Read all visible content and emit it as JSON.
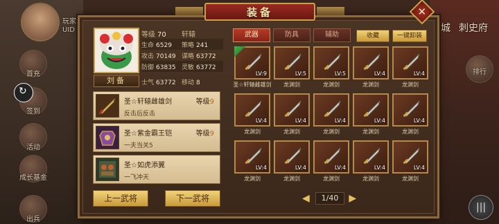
{
  "background": {
    "top_left_label_1": "玩家",
    "top_left_label_2": "UID",
    "top_right_labels": [
      "城",
      "刺史府"
    ],
    "left_menu": [
      "首充",
      "签到",
      "活动",
      "成长基金",
      "出兵"
    ],
    "right_menu": [
      "排行"
    ]
  },
  "panel": {
    "title": "装备",
    "close_symbol": "✕"
  },
  "hero": {
    "name_tag": "刘备",
    "stats": [
      [
        {
          "k": "等级",
          "v": "70"
        },
        {
          "k": "轩辕",
          "v": ""
        }
      ],
      [
        {
          "k": "生命",
          "v": "6529"
        },
        {
          "k": "策略",
          "v": "241"
        }
      ],
      [
        {
          "k": "攻击",
          "v": "70149"
        },
        {
          "k": "谋略",
          "v": "63772"
        }
      ],
      [
        {
          "k": "防御",
          "v": "63835"
        },
        {
          "k": "灵敏",
          "v": "63772"
        }
      ],
      [
        {
          "k": "士气",
          "v": "63772"
        },
        {
          "k": "移动",
          "v": "8"
        }
      ]
    ]
  },
  "equipped": [
    {
      "name": "圣☆轩辕雌雄剑",
      "level_label": "等级",
      "level": "9",
      "desc": "反击后反击"
    },
    {
      "name": "圣☆紫金霸王铠",
      "level_label": "等级",
      "level": "9",
      "desc": "一夫当关5"
    },
    {
      "name": "圣☆如虎添翼",
      "level_label": "",
      "level": "",
      "desc": "一飞冲天"
    }
  ],
  "buttons": {
    "prev_hero": "上一武将",
    "next_hero": "下一武将",
    "collect": "收藏",
    "unequip_all": "一键卸装"
  },
  "tabs": [
    {
      "label": "武器",
      "active": true
    },
    {
      "label": "防具",
      "active": false
    },
    {
      "label": "辅助",
      "active": false
    }
  ],
  "inventory": [
    {
      "name": "圣☆轩辕雌雄剑",
      "lv": "LV:9",
      "badge": true
    },
    {
      "name": "龙渊剑",
      "lv": "LV:5",
      "badge": false
    },
    {
      "name": "龙渊剑",
      "lv": "LV:5",
      "badge": false
    },
    {
      "name": "龙渊剑",
      "lv": "LV:4",
      "badge": false
    },
    {
      "name": "龙渊剑",
      "lv": "LV:4",
      "badge": false
    },
    {
      "name": "龙渊剑",
      "lv": "LV:4",
      "badge": false
    },
    {
      "name": "龙渊剑",
      "lv": "LV:4",
      "badge": false
    },
    {
      "name": "龙渊剑",
      "lv": "LV:4",
      "badge": false
    },
    {
      "name": "龙渊剑",
      "lv": "LV:4",
      "badge": false
    },
    {
      "name": "龙渊剑",
      "lv": "LV:4",
      "badge": false
    },
    {
      "name": "龙渊剑",
      "lv": "LV:4",
      "badge": false
    },
    {
      "name": "龙渊剑",
      "lv": "LV:4",
      "badge": false
    },
    {
      "name": "龙渊剑",
      "lv": "LV:4",
      "badge": false
    },
    {
      "name": "龙渊剑",
      "lv": "LV:4",
      "badge": false
    },
    {
      "name": "龙渊剑",
      "lv": "LV:4",
      "badge": false
    }
  ],
  "pager": {
    "text": "1/40",
    "prev_symbol": "◀",
    "next_symbol": "▶"
  }
}
